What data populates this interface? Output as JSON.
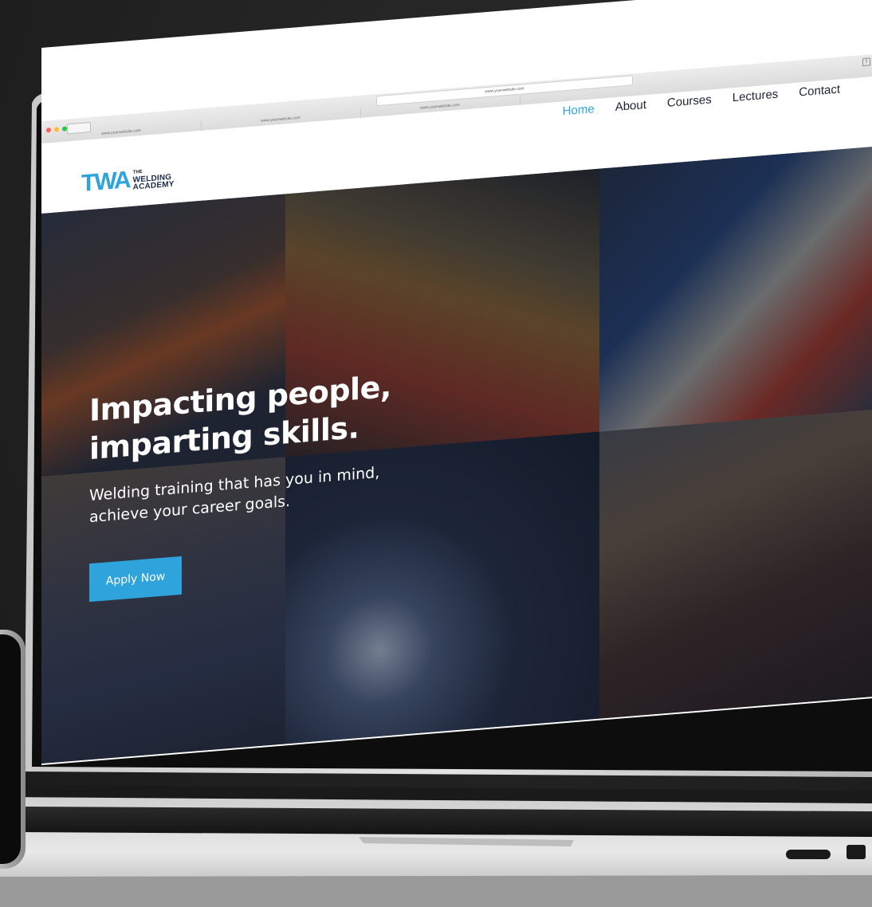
{
  "browser": {
    "address": "www.yourwebsite.com",
    "tabs": [
      "www.yourwebsite.com",
      "www.yourwebsite.com",
      "www.yourwebsite.com"
    ],
    "traffic_lights": [
      "#ff5f57",
      "#febc2e",
      "#28c840"
    ]
  },
  "site": {
    "logo": {
      "mark": "TWA",
      "the": "THE",
      "name_line1": "WELDING",
      "name_line2": "ACADEMY"
    },
    "nav": [
      {
        "label": "Home",
        "active": true
      },
      {
        "label": "About",
        "active": false
      },
      {
        "label": "Courses",
        "active": false
      },
      {
        "label": "Lectures",
        "active": false
      },
      {
        "label": "Contact",
        "active": false
      }
    ],
    "hero": {
      "headline_line1": "Impacting people,",
      "headline_line2": "imparting skills.",
      "subheadline": "Welding training that has you in mind, achieve your career goals.",
      "cta_label": "Apply Now"
    }
  },
  "colors": {
    "accent": "#2ea3dc",
    "nav_text": "#1d2636",
    "hero_overlay": "#0e1628"
  }
}
